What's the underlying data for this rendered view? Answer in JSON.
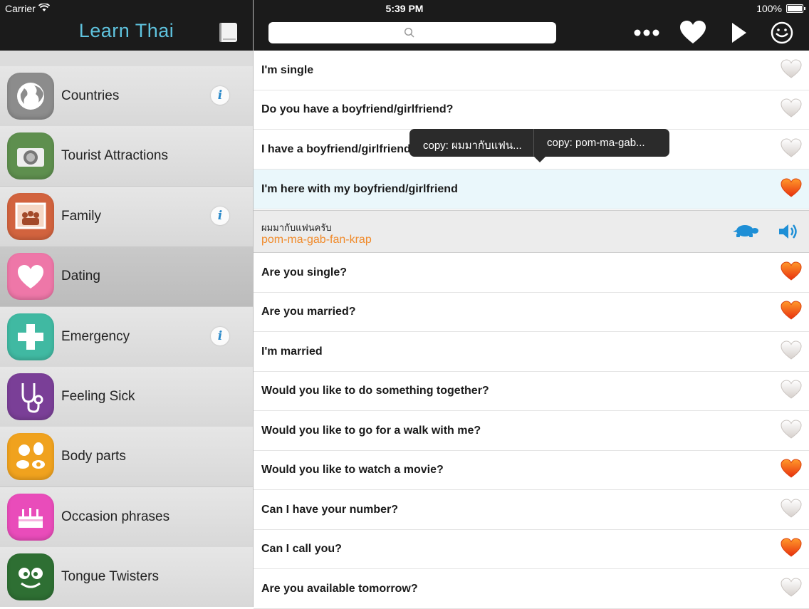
{
  "status": {
    "carrier": "Carrier",
    "time": "5:39 PM",
    "battery": "100%"
  },
  "sidebar": {
    "title": "Learn Thai",
    "categories": [
      {
        "label": "Countries",
        "icon": "globe-icon",
        "color": "#8c8c8c",
        "info": true
      },
      {
        "label": "Tourist Attractions",
        "icon": "camera-icon",
        "color": "#5e8f4e",
        "info": false
      },
      {
        "label": "Family",
        "icon": "family-picture-icon",
        "color": "#d2633e",
        "info": true
      },
      {
        "label": "Dating",
        "icon": "heart-icon",
        "color": "#ee77a8",
        "info": false,
        "selected": true
      },
      {
        "label": "Emergency",
        "icon": "cross-icon",
        "color": "#40b9a2",
        "info": true
      },
      {
        "label": "Feeling Sick",
        "icon": "stethoscope-icon",
        "color": "#7a3f97",
        "info": false
      },
      {
        "label": "Body parts",
        "icon": "body-parts-icon",
        "color": "#f0a21e",
        "info": false
      },
      {
        "label": "Occasion phrases",
        "icon": "cake-icon",
        "color": "#e94cba",
        "info": false
      },
      {
        "label": "Tongue Twisters",
        "icon": "silly-face-icon",
        "color": "#2e6f33",
        "info": false
      }
    ]
  },
  "toolbar": {
    "search_placeholder": "",
    "icons": [
      "more-icon",
      "favorites-heart-icon",
      "play-icon",
      "smiley-icon"
    ]
  },
  "phrases": [
    {
      "text": "I'm single",
      "favorite": false
    },
    {
      "text": "Do you have a boyfriend/girlfriend?",
      "favorite": false
    },
    {
      "text": "I have a boyfriend/girlfriend",
      "favorite": false
    },
    {
      "text": "I'm here with my boyfriend/girlfriend",
      "favorite": true,
      "selected": true
    },
    {
      "text": "Are you single?",
      "favorite": true
    },
    {
      "text": "Are you married?",
      "favorite": true
    },
    {
      "text": "I'm married",
      "favorite": false
    },
    {
      "text": "Would you like to do something together?",
      "favorite": false
    },
    {
      "text": "Would you like to go for a walk with me?",
      "favorite": false
    },
    {
      "text": "Would you like to watch a movie?",
      "favorite": true
    },
    {
      "text": "Can I have your number?",
      "favorite": false
    },
    {
      "text": "Can I call you?",
      "favorite": true
    },
    {
      "text": "Are you available tomorrow?",
      "favorite": false
    }
  ],
  "detail": {
    "thai": "ผมมากับแฟนครับ",
    "romanization": "pom-ma-gab-fan-krap"
  },
  "popup": {
    "copy_thai": "copy: ผมมากับแฟน...",
    "copy_roman": "copy: pom-ma-gab..."
  },
  "colors": {
    "accent": "#5fc3de",
    "romanization": "#f08a2a",
    "favorite": "#f25a1c",
    "speaker": "#1e8fd6",
    "turtle": "#1e8fd6"
  }
}
